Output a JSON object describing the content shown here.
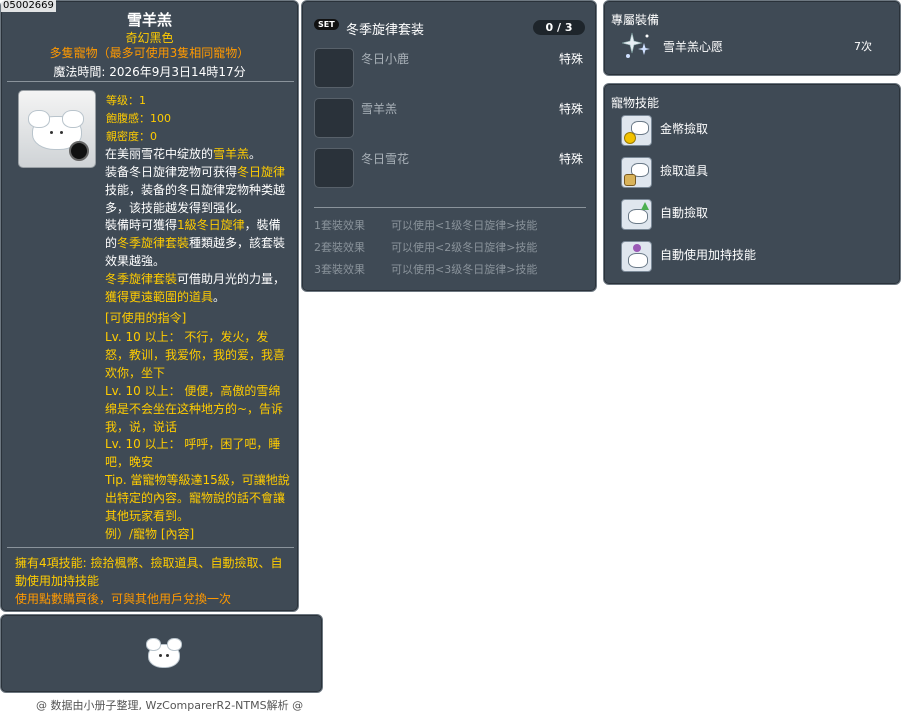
{
  "item_id": "05002669",
  "item": {
    "name": "雪羊羔",
    "subname": "奇幻黑色",
    "pet_type": "多隻寵物（最多可使用3隻相同寵物）",
    "magic_time": "魔法時間: 2026年9月3日14時17分",
    "stats": {
      "level": "等级：1",
      "fullness": "飽腹感：100",
      "closeness": "親密度：0"
    },
    "desc": {
      "p1_a": "在美丽雪花中绽放的",
      "p1_b": "雪羊羔",
      "p1_c": "。",
      "p2_a": "装备冬日旋律宠物可获得",
      "p2_b": "冬日旋律",
      "p2_c": "技能，装备的冬日旋律宠物种类越多，该技能越发得到强化。",
      "p3_a": "裝備時可獲得",
      "p3_b": "1級冬日旋律",
      "p3_c": "，裝備的",
      "p3_d": "冬季旋律套裝",
      "p3_e": "種類越多，該套裝效果越強。",
      "p4_a": "冬季旋律套裝",
      "p4_b": "可借助月光的力量，",
      "p4_c": "獲得更遠範圍的道具",
      "p4_d": "。"
    },
    "commands": {
      "header": "[可使用的指令]",
      "c1": "Lv. 10 以上： 不行，发火，发怒，教训，我爱你，我的爱，我喜欢你，坐下",
      "c2": "Lv. 10 以上： 便便，高傲的雪绵绵是不会坐在这种地方的~，告诉我，说，说话",
      "c3": "Lv. 10 以上： 呼呼，困了吧，睡吧，晚安",
      "tip": "Tip. 當寵物等級達15級，可讓牠說出特定的內容。寵物說的話不會讓其他玩家看到。",
      "example": "例）/寵物 [內容]"
    },
    "footer": {
      "skills": "擁有4項技能: 撿拾楓幣、撿取道具、自動撿取、自動使用加持技能",
      "trade": "使用點數購買後，可與其他用戶兌換一次"
    }
  },
  "set": {
    "badge": "SET",
    "title": "冬季旋律套装",
    "count": "0 / 3",
    "items": [
      {
        "name": "冬日小鹿",
        "type": "特殊"
      },
      {
        "name": "雪羊羔",
        "type": "特殊"
      },
      {
        "name": "冬日雪花",
        "type": "特殊"
      }
    ],
    "effects": [
      {
        "label": "1套裝效果",
        "text": "可以使用<1级冬日旋律>技能"
      },
      {
        "label": "2套裝效果",
        "text": "可以使用<2级冬日旋律>技能"
      },
      {
        "label": "3套裝效果",
        "text": "可以使用<3级冬日旋律>技能"
      }
    ]
  },
  "equip": {
    "title": "專屬裝備",
    "item_name": "雪羊羔心愿",
    "item_count": "7次"
  },
  "skills": {
    "title": "寵物技能",
    "items": [
      {
        "name": "金幣撿取",
        "icon": "meso-pickup-icon"
      },
      {
        "name": "撿取道具",
        "icon": "item-pickup-icon"
      },
      {
        "name": "自動撿取",
        "icon": "auto-pickup-icon"
      },
      {
        "name": "自動使用加持技能",
        "icon": "auto-buff-icon"
      }
    ]
  },
  "footer_text": "@ 数据由小册子整理, WzComparerR2-NTMS解析 @"
}
